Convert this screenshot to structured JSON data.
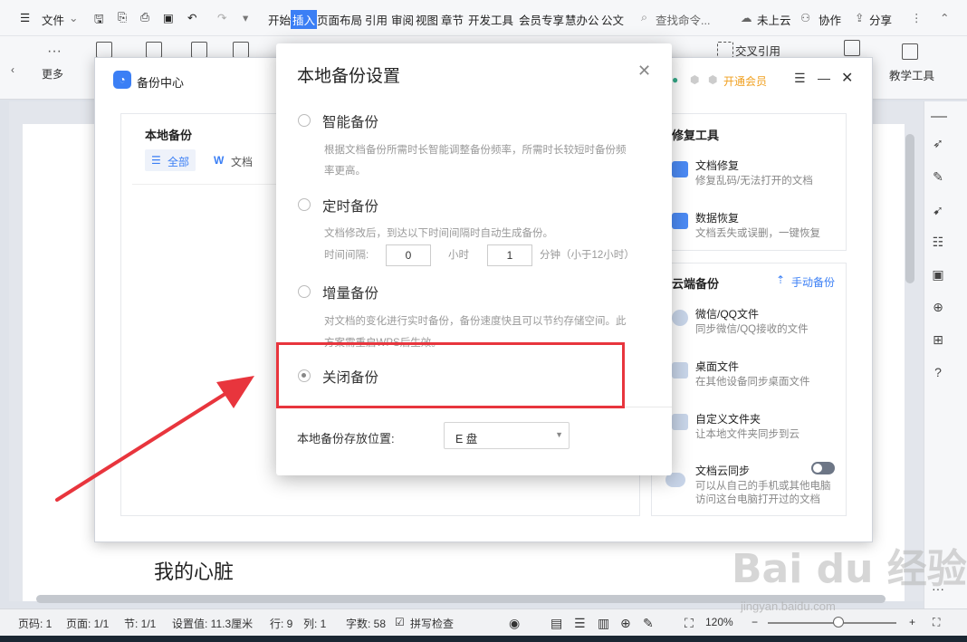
{
  "menubar": {
    "file": "文件",
    "tabs": [
      "开始",
      "插入",
      "页面布局",
      "引用",
      "审阅",
      "视图",
      "章节",
      "开发工具",
      "会员专享",
      "慧办公",
      "公文"
    ],
    "active_tab": "插入",
    "search": "查找命令...",
    "cloud": "未上云",
    "collab": "协作",
    "share": "分享"
  },
  "toolbar": {
    "more": "更多",
    "cross_ref": "交叉引用",
    "teach_tool": "教学工具"
  },
  "backup_center": {
    "title": "备份中心",
    "vip": "开通会员",
    "local_backup": "本地备份",
    "filter_all": "全部",
    "filter_doc": "文档",
    "repair_tools": "修复工具",
    "doc_repair": "文档修复",
    "doc_repair_sub": "修复乱码/无法打开的文档",
    "data_recover": "数据恢复",
    "data_recover_sub": "文档丢失或误删，一键恢复",
    "cloud_backup": "云端备份",
    "manual_backup": "手动备份",
    "wechat": "微信/QQ文件",
    "wechat_sub": "同步微信/QQ接收的文件",
    "desktop": "桌面文件",
    "desktop_sub": "在其他设备同步桌面文件",
    "custom_folder": "自定义文件夹",
    "custom_folder_sub": "让本地文件夹同步到云",
    "cloud_sync": "文档云同步",
    "cloud_sync_sub1": "可以从自己的手机或其他电脑",
    "cloud_sync_sub2": "访问这台电脑打开过的文档"
  },
  "modal": {
    "title": "本地备份设置",
    "opt1": "智能备份",
    "opt1_desc1": "根据文档备份所需时长智能调整备份频率，所需时长较短时备份频",
    "opt1_desc2": "率更高。",
    "opt2": "定时备份",
    "opt2_desc": "文档修改后，到达以下时间间隔时自动生成备份。",
    "interval_label": "时间间隔:",
    "hours_value": "0",
    "hours_unit": "小时",
    "minutes_value": "1",
    "minutes_unit": "分钟（小于12小时）",
    "opt3": "增量备份",
    "opt3_desc1": "对文档的变化进行实时备份，备份速度快且可以节约存储空间。此",
    "opt3_desc2": "方案需重启WPS后生效。",
    "opt4": "关闭备份",
    "selected_option": "关闭备份",
    "location_label": "本地备份存放位置:",
    "location_value": "E 盘"
  },
  "document": {
    "text": "我的心脏"
  },
  "statusbar": {
    "page": "页码: 1",
    "pages": "页面: 1/1",
    "section": "节: 1/1",
    "setting": "设置值: 11.3厘米",
    "row": "行: 9",
    "col": "列: 1",
    "words": "字数: 58",
    "spell": "拼写检查",
    "zoom": "120%"
  },
  "watermark": {
    "brand": "Bai du 经验",
    "url": "jingyan.baidu.com"
  },
  "colors": {
    "accent": "#3b7ff5",
    "annotation_red": "#e8353d",
    "vip_orange": "#f0a020"
  }
}
